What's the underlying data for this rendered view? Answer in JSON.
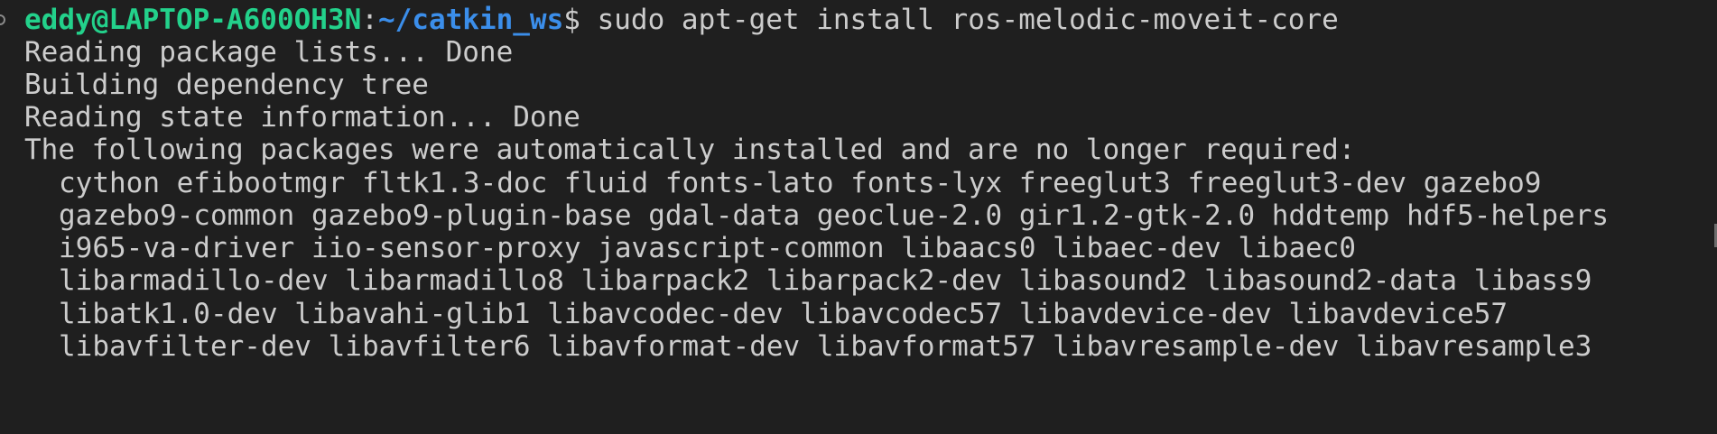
{
  "prompt": {
    "user_host": "eddy@LAPTOP-A600OH3N",
    "separator": ":",
    "path": "~/catkin_ws",
    "symbol": "$",
    "command": " sudo apt-get install ros-melodic-moveit-core"
  },
  "output": {
    "lines": [
      "Reading package lists... Done",
      "Building dependency tree",
      "Reading state information... Done",
      "The following packages were automatically installed and are no longer required:"
    ],
    "package_lines": [
      "cython efibootmgr fltk1.3-doc fluid fonts-lato fonts-lyx freeglut3 freeglut3-dev gazebo9",
      "gazebo9-common gazebo9-plugin-base gdal-data geoclue-2.0 gir1.2-gtk-2.0 hddtemp hdf5-helpers",
      "i965-va-driver iio-sensor-proxy javascript-common libaacs0 libaec-dev libaec0",
      "libarmadillo-dev libarmadillo8 libarpack2 libarpack2-dev libasound2 libasound2-data libass9",
      "libatk1.0-dev libavahi-glib1 libavcodec-dev libavcodec57 libavdevice-dev libavdevice57",
      "libavfilter-dev libavfilter6 libavformat-dev libavformat57 libavresample-dev libavresample3"
    ]
  },
  "colors": {
    "background": "#1f1f1f",
    "user_host": "#23d18b",
    "path": "#3b8eea",
    "text": "#cccccc"
  }
}
